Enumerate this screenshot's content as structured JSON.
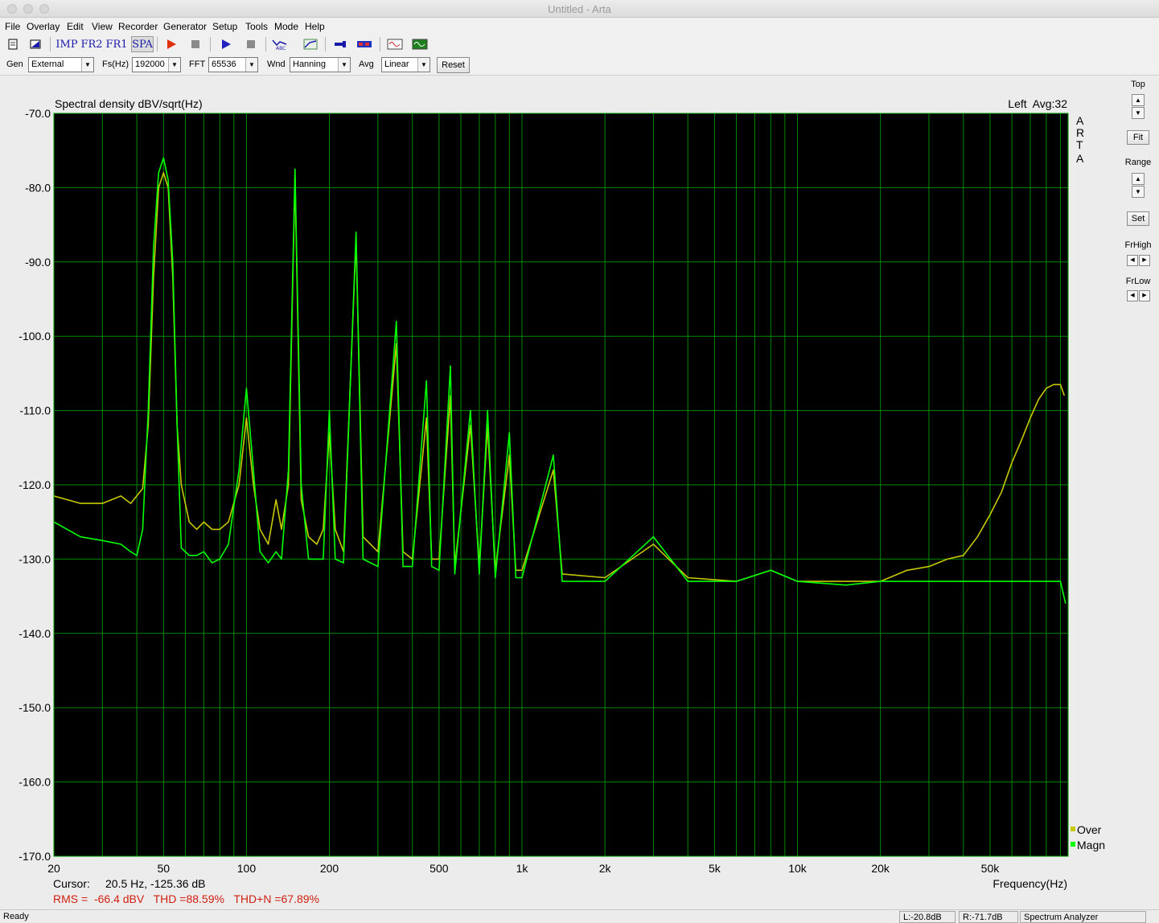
{
  "window": {
    "title": "Untitled - Arta"
  },
  "menu": [
    "File",
    "Overlay",
    "Edit",
    "View",
    "Recorder",
    "Generator",
    "Setup",
    "Tools",
    "Mode",
    "Help"
  ],
  "toolbar": {
    "imp_label": "IMP",
    "fr2_label": "FR2",
    "fr1_label": "FR1",
    "spa_label": "SPA",
    "icons": [
      "new-file-icon",
      "open-file-icon",
      "record-icon",
      "stop-icon",
      "play-icon",
      "stop-icon",
      "abc-icon",
      "grid-icon",
      "scope-icon",
      "level-icon",
      "sine-icon",
      "wave-icon"
    ]
  },
  "controls": {
    "gen_label": "Gen",
    "gen_value": "External",
    "fs_label": "Fs(Hz)",
    "fs_value": "192000",
    "fft_label": "FFT",
    "fft_value": "65536",
    "wnd_label": "Wnd",
    "wnd_value": "Hanning",
    "avg_label": "Avg",
    "avg_value": "Linear",
    "reset_label": "Reset"
  },
  "right_panel": {
    "top_label": "Top",
    "fit_label": "Fit",
    "range_label": "Range",
    "set_label": "Set",
    "frhigh_label": "FrHigh",
    "frlow_label": "FrLow"
  },
  "chart_data": {
    "type": "line",
    "title": "Spectral density dBV/sqrt(Hz)",
    "channel_info": "Left  Avg:32",
    "brand": [
      "A",
      "R",
      "T",
      "A"
    ],
    "xlabel": "Frequency(Hz)",
    "x_scale": "log",
    "xlim": [
      20,
      96000
    ],
    "ylim": [
      -170,
      -70
    ],
    "x_ticks": [
      {
        "value": 20,
        "label": "20"
      },
      {
        "value": 50,
        "label": "50"
      },
      {
        "value": 100,
        "label": "100"
      },
      {
        "value": 200,
        "label": "200"
      },
      {
        "value": 500,
        "label": "500"
      },
      {
        "value": 1000,
        "label": "1k"
      },
      {
        "value": 2000,
        "label": "2k"
      },
      {
        "value": 5000,
        "label": "5k"
      },
      {
        "value": 10000,
        "label": "10k"
      },
      {
        "value": 20000,
        "label": "20k"
      },
      {
        "value": 50000,
        "label": "50k"
      }
    ],
    "y_ticks": [
      {
        "value": -70,
        "label": "-70.0"
      },
      {
        "value": -80,
        "label": "-80.0"
      },
      {
        "value": -90,
        "label": "-90.0"
      },
      {
        "value": -100,
        "label": "-100.0"
      },
      {
        "value": -110,
        "label": "-110.0"
      },
      {
        "value": -120,
        "label": "-120.0"
      },
      {
        "value": -130,
        "label": "-130.0"
      },
      {
        "value": -140,
        "label": "-140.0"
      },
      {
        "value": -150,
        "label": "-150.0"
      },
      {
        "value": -160,
        "label": "-160.0"
      },
      {
        "value": -170,
        "label": "-170.0"
      }
    ],
    "grid": true,
    "legend_position": "bottom-right",
    "series": [
      {
        "name": "Over",
        "color": "#c8c800",
        "points": [
          [
            20,
            -121.5
          ],
          [
            25,
            -122.5
          ],
          [
            30,
            -122.5
          ],
          [
            35,
            -121.5
          ],
          [
            38,
            -122.5
          ],
          [
            42,
            -120.5
          ],
          [
            44,
            -112
          ],
          [
            46,
            -92
          ],
          [
            48,
            -80
          ],
          [
            50,
            -78
          ],
          [
            52,
            -80
          ],
          [
            54,
            -92
          ],
          [
            56,
            -112
          ],
          [
            58,
            -120
          ],
          [
            62,
            -125
          ],
          [
            66,
            -126
          ],
          [
            70,
            -125
          ],
          [
            75,
            -126
          ],
          [
            80,
            -126
          ],
          [
            86,
            -125
          ],
          [
            94,
            -120
          ],
          [
            100,
            -111
          ],
          [
            106,
            -120
          ],
          [
            112,
            -126
          ],
          [
            120,
            -128
          ],
          [
            128,
            -122
          ],
          [
            134,
            -126
          ],
          [
            142,
            -120
          ],
          [
            150,
            -78.5
          ],
          [
            158,
            -122
          ],
          [
            168,
            -127
          ],
          [
            180,
            -128
          ],
          [
            190,
            -126
          ],
          [
            200,
            -113
          ],
          [
            210,
            -126
          ],
          [
            225,
            -129
          ],
          [
            250,
            -87
          ],
          [
            265,
            -127
          ],
          [
            300,
            -129
          ],
          [
            350,
            -101
          ],
          [
            370,
            -129
          ],
          [
            400,
            -130
          ],
          [
            450,
            -111
          ],
          [
            470,
            -130
          ],
          [
            500,
            -130
          ],
          [
            550,
            -108
          ],
          [
            570,
            -131
          ],
          [
            650,
            -112
          ],
          [
            700,
            -131
          ],
          [
            750,
            -112
          ],
          [
            800,
            -131.5
          ],
          [
            900,
            -116
          ],
          [
            950,
            -131.5
          ],
          [
            1000,
            -131.5
          ],
          [
            1300,
            -118
          ],
          [
            1400,
            -132
          ],
          [
            2000,
            -132.5
          ],
          [
            3000,
            -128
          ],
          [
            4000,
            -132.5
          ],
          [
            6000,
            -133
          ],
          [
            8000,
            -131.5
          ],
          [
            10000,
            -133
          ],
          [
            15000,
            -133
          ],
          [
            20000,
            -133
          ],
          [
            25000,
            -131.5
          ],
          [
            30000,
            -131
          ],
          [
            35000,
            -130
          ],
          [
            40000,
            -129.5
          ],
          [
            45000,
            -127
          ],
          [
            50000,
            -124
          ],
          [
            55000,
            -121
          ],
          [
            60000,
            -117
          ],
          [
            65000,
            -114
          ],
          [
            70000,
            -111
          ],
          [
            75000,
            -108.5
          ],
          [
            80000,
            -107
          ],
          [
            85000,
            -106.5
          ],
          [
            90000,
            -106.5
          ],
          [
            93000,
            -108
          ]
        ]
      },
      {
        "name": "Magn",
        "color": "#00ff00",
        "points": [
          [
            20,
            -125
          ],
          [
            25,
            -127
          ],
          [
            30,
            -127.5
          ],
          [
            35,
            -128
          ],
          [
            38,
            -129
          ],
          [
            40,
            -129.5
          ],
          [
            42,
            -126
          ],
          [
            44,
            -110
          ],
          [
            46,
            -88
          ],
          [
            48,
            -78
          ],
          [
            50,
            -76
          ],
          [
            52,
            -79
          ],
          [
            54,
            -90
          ],
          [
            56,
            -112
          ],
          [
            58,
            -128.5
          ],
          [
            62,
            -129.5
          ],
          [
            66,
            -129.5
          ],
          [
            70,
            -129
          ],
          [
            75,
            -130.5
          ],
          [
            80,
            -130
          ],
          [
            86,
            -128
          ],
          [
            94,
            -118
          ],
          [
            100,
            -107
          ],
          [
            106,
            -118
          ],
          [
            112,
            -129
          ],
          [
            120,
            -130.5
          ],
          [
            128,
            -129
          ],
          [
            134,
            -130
          ],
          [
            142,
            -118
          ],
          [
            150,
            -77.5
          ],
          [
            158,
            -120
          ],
          [
            168,
            -130
          ],
          [
            180,
            -130
          ],
          [
            190,
            -130
          ],
          [
            200,
            -110
          ],
          [
            210,
            -130
          ],
          [
            225,
            -130.5
          ],
          [
            250,
            -86
          ],
          [
            265,
            -130
          ],
          [
            300,
            -131
          ],
          [
            350,
            -98
          ],
          [
            370,
            -131
          ],
          [
            400,
            -131
          ],
          [
            450,
            -106
          ],
          [
            470,
            -131
          ],
          [
            500,
            -131.5
          ],
          [
            550,
            -104
          ],
          [
            570,
            -132
          ],
          [
            650,
            -110
          ],
          [
            700,
            -132
          ],
          [
            750,
            -110
          ],
          [
            800,
            -132.5
          ],
          [
            900,
            -113
          ],
          [
            950,
            -132.5
          ],
          [
            1000,
            -132.5
          ],
          [
            1300,
            -116
          ],
          [
            1400,
            -133
          ],
          [
            2000,
            -133
          ],
          [
            3000,
            -127
          ],
          [
            4000,
            -133
          ],
          [
            6000,
            -133
          ],
          [
            8000,
            -131.5
          ],
          [
            10000,
            -133
          ],
          [
            15000,
            -133.5
          ],
          [
            20000,
            -133
          ],
          [
            30000,
            -133
          ],
          [
            40000,
            -133
          ],
          [
            50000,
            -133
          ],
          [
            60000,
            -133
          ],
          [
            70000,
            -133
          ],
          [
            80000,
            -133
          ],
          [
            90000,
            -133
          ],
          [
            94000,
            -136
          ]
        ]
      }
    ],
    "cursor_label": "Cursor:",
    "cursor_value": "20.5 Hz, -125.36 dB",
    "stats": "RMS =  -66.4 dBV   THD =88.59%   THD+N =67.89%"
  },
  "status": {
    "ready": "Ready",
    "left_level": "L:-20.8dB",
    "right_level": "R:-71.7dB",
    "mode": "Spectrum Analyzer"
  }
}
